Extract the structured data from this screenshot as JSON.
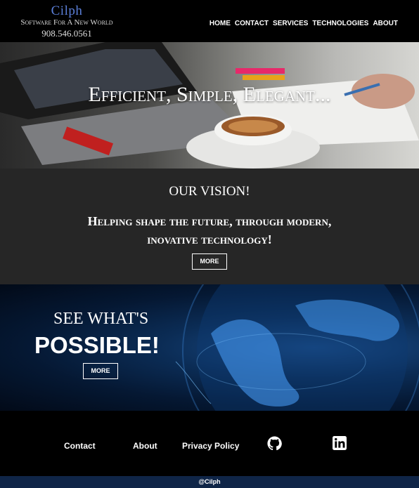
{
  "header": {
    "brand_name": "Cilph",
    "tagline": "Software For A New World",
    "phone": "908.546.0561",
    "nav": [
      "HOME",
      "CONTACT",
      "SERVICES",
      "TECHNOLOGIES",
      "ABOUT"
    ]
  },
  "hero": {
    "title": "Efficient, Simple, Elegant..."
  },
  "vision": {
    "title": "OUR VISION!",
    "text": "Helping shape the future, through modern, inovative technology!",
    "button": "MORE"
  },
  "possible": {
    "line1": "SEE WHAT'S",
    "line2": "POSSIBLE!",
    "button": "MORE"
  },
  "footer": {
    "links": [
      "Contact",
      "About",
      "Privacy Policy"
    ],
    "icons": [
      "github-icon",
      "linkedin-icon"
    ],
    "copyright": "@Cilph"
  },
  "colors": {
    "brand": "#5b7fd8",
    "vision_bg": "#262626",
    "bottom_bar": "#0f2547"
  }
}
